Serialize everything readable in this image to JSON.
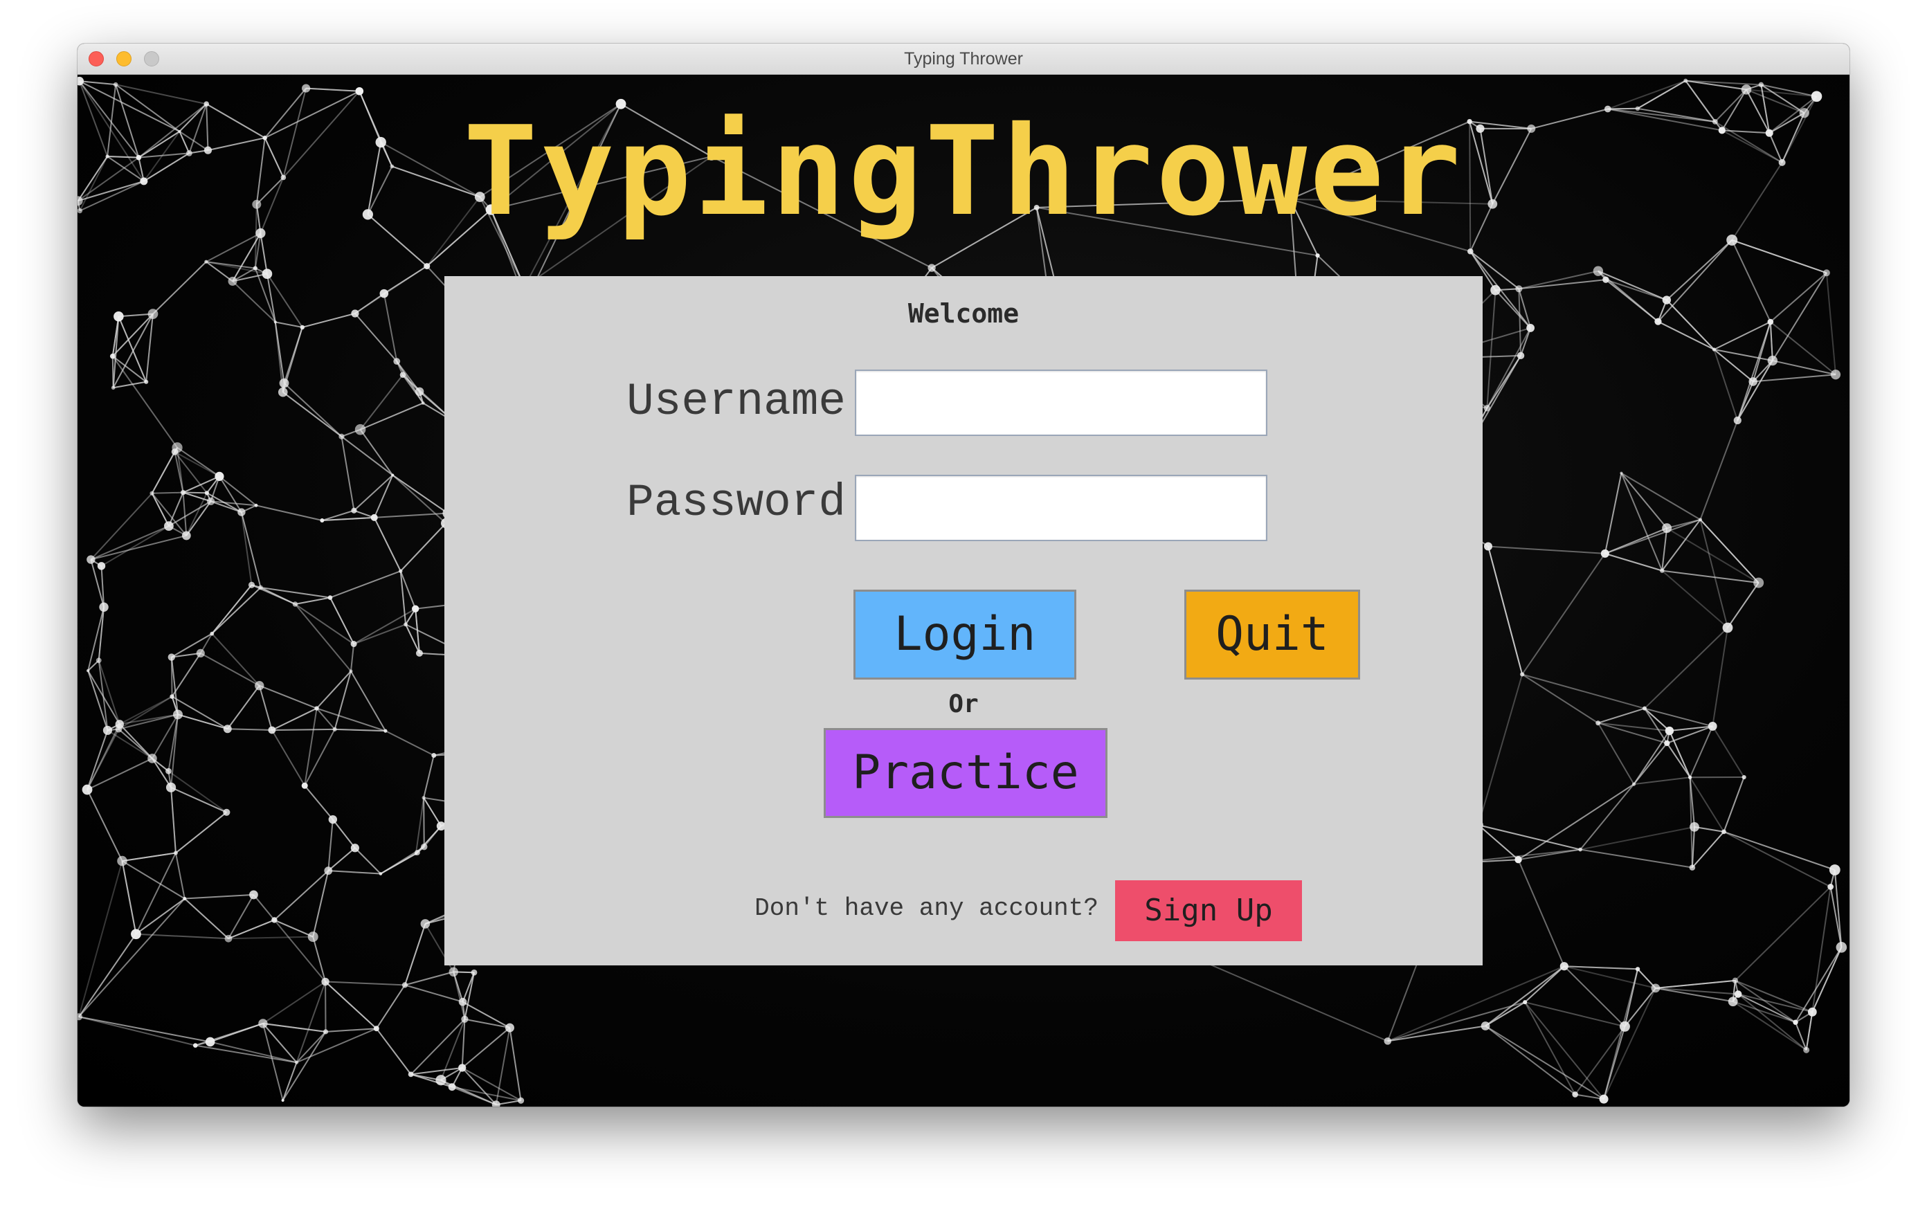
{
  "window": {
    "title": "Typing Thrower"
  },
  "app": {
    "title": "TypingThrower",
    "title_color": "#f5cf4a"
  },
  "login_panel": {
    "heading": "Welcome",
    "username_label": "Username",
    "username_value": "",
    "password_label": "Password",
    "password_value": "",
    "login_label": "Login",
    "quit_label": "Quit",
    "or_text": "Or",
    "practice_label": "Practice",
    "signup_prompt": "Don't have any account?",
    "signup_label": "Sign Up"
  },
  "colors": {
    "panel": "#d3d3d3",
    "login_button": "#62b5fb",
    "quit_button": "#f2aa14",
    "practice_button": "#b65cf9",
    "signup_button": "#ee4e6b"
  },
  "background": {
    "style": "network-mesh",
    "icon": "constellation-graph"
  }
}
